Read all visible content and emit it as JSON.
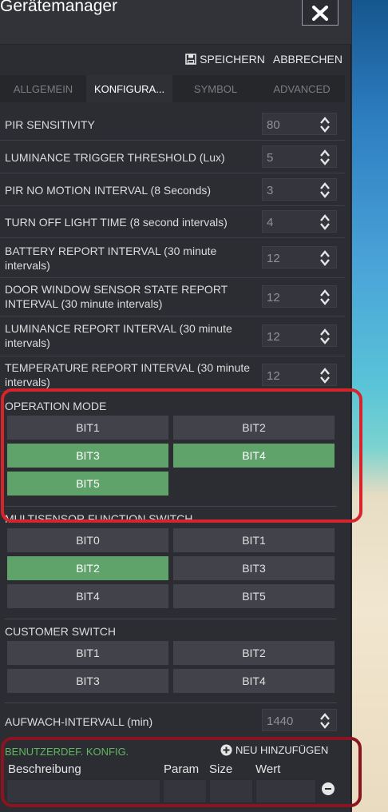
{
  "app": {
    "title": "Gerätemanager"
  },
  "actions": {
    "save_label": "SPEICHERN",
    "cancel_label": "ABBRECHEN"
  },
  "tabs": [
    {
      "label": "ALLGEMEIN",
      "active": false
    },
    {
      "label": "KONFIGURA...",
      "active": true
    },
    {
      "label": "SYMBOL",
      "active": false
    },
    {
      "label": "ADVANCED",
      "active": false
    }
  ],
  "params": [
    {
      "label": "PIR SENSITIVITY",
      "value": "80"
    },
    {
      "label": "LUMINANCE TRIGGER THRESHOLD (Lux)",
      "value": "5"
    },
    {
      "label": "PIR NO MOTION INTERVAL (8 Seconds)",
      "value": "3"
    },
    {
      "label": "TURN OFF LIGHT TIME (8 second intervals)",
      "value": "4"
    },
    {
      "label": "BATTERY REPORT INTERVAL (30 minute intervals)",
      "value": "12"
    },
    {
      "label": "DOOR WINDOW SENSOR STATE REPORT INTERVAL (30 minute intervals)",
      "value": "12"
    },
    {
      "label": "LUMINANCE REPORT INTERVAL (30 minute intervals)",
      "value": "12"
    },
    {
      "label": "TEMPERATURE REPORT INTERVAL (30 minute intervals)",
      "value": "12"
    }
  ],
  "operation_mode": {
    "title": "OPERATION MODE",
    "bits": [
      {
        "label": "BIT1",
        "on": false
      },
      {
        "label": "BIT2",
        "on": false
      },
      {
        "label": "BIT3",
        "on": true
      },
      {
        "label": "BIT4",
        "on": true
      },
      {
        "label": "BIT5",
        "on": true
      }
    ]
  },
  "multisensor": {
    "title": "MULTISENSOR FUNCTION SWITCH",
    "bits": [
      {
        "label": "BIT0",
        "on": false
      },
      {
        "label": "BIT1",
        "on": false
      },
      {
        "label": "BIT2",
        "on": true
      },
      {
        "label": "BIT3",
        "on": false
      },
      {
        "label": "BIT4",
        "on": false
      },
      {
        "label": "BIT5",
        "on": false
      }
    ]
  },
  "customer_switch": {
    "title": "CUSTOMER SWITCH",
    "bits": [
      {
        "label": "BIT1",
        "on": false
      },
      {
        "label": "BIT2",
        "on": false
      },
      {
        "label": "BIT3",
        "on": false
      },
      {
        "label": "BIT4",
        "on": false
      }
    ]
  },
  "wake": {
    "label": "AUFWACH-INTERVALL (min)",
    "value": "1440"
  },
  "custom": {
    "title": "BENUTZERDEF. KONFIG.",
    "add_label": "NEU HINZUFÜGEN",
    "columns": {
      "description": "Beschreibung",
      "param": "Param",
      "size": "Size",
      "value": "Wert"
    }
  },
  "colors": {
    "accent_green": "#5fa36b",
    "highlight_red": "#d6242c",
    "highlight_dark_red": "#8a1520",
    "custom_title_green": "#5fb75f"
  },
  "icons": {
    "tool": "tools-cross-icon",
    "save": "floppy-disk-icon",
    "add": "plus-circle-icon",
    "remove": "minus-circle-icon",
    "stepper": "up-down-arrows-icon"
  }
}
